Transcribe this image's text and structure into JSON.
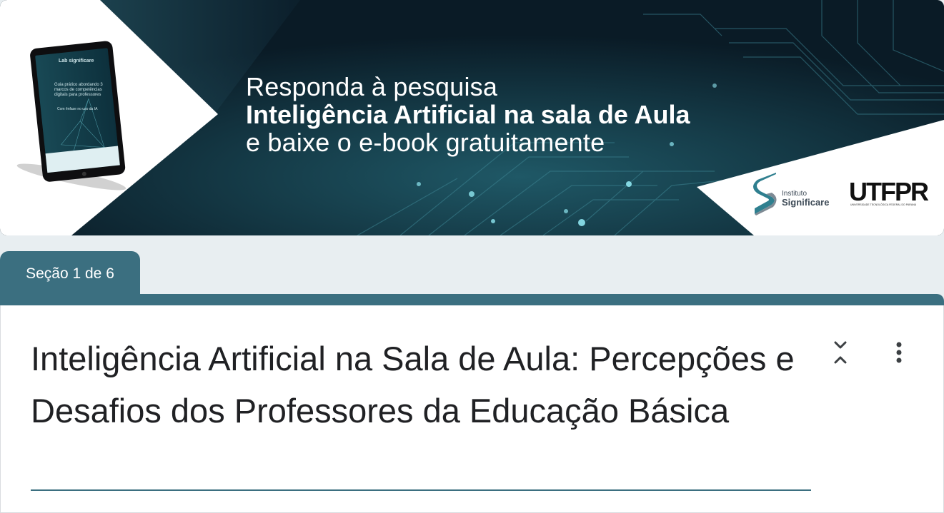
{
  "banner": {
    "headline_line1": "Responda à pesquisa",
    "headline_line2": "Inteligência Artificial na sala de Aula",
    "headline_line3": "e baixe o e-book gratuitamente",
    "tablet_brand": "Lab significare",
    "tablet_text": "Guia prático abordando 3 marcos de competências digitais para professores",
    "tablet_subtext": "Com ênfase no uso da IA",
    "logo_significare_line1": "Instituto",
    "logo_significare_line2": "Significare",
    "logo_utfpr": "UTFPR",
    "logo_utfpr_sub": "UNIVERSIDADE TECNOLÓGICA FEDERAL DO PARANÁ"
  },
  "section": {
    "label": "Seção 1 de 6"
  },
  "form": {
    "title": "Inteligência Artificial na Sala de Aula: Percepções e Desafios dos Professores da Educação Básica"
  },
  "icons": {
    "collapse": "collapse-icon",
    "more": "more-vert-icon"
  },
  "colors": {
    "accent": "#3b6f80",
    "banner_dark": "#0c1f2b",
    "text": "#202124",
    "background": "#e8eef1"
  }
}
